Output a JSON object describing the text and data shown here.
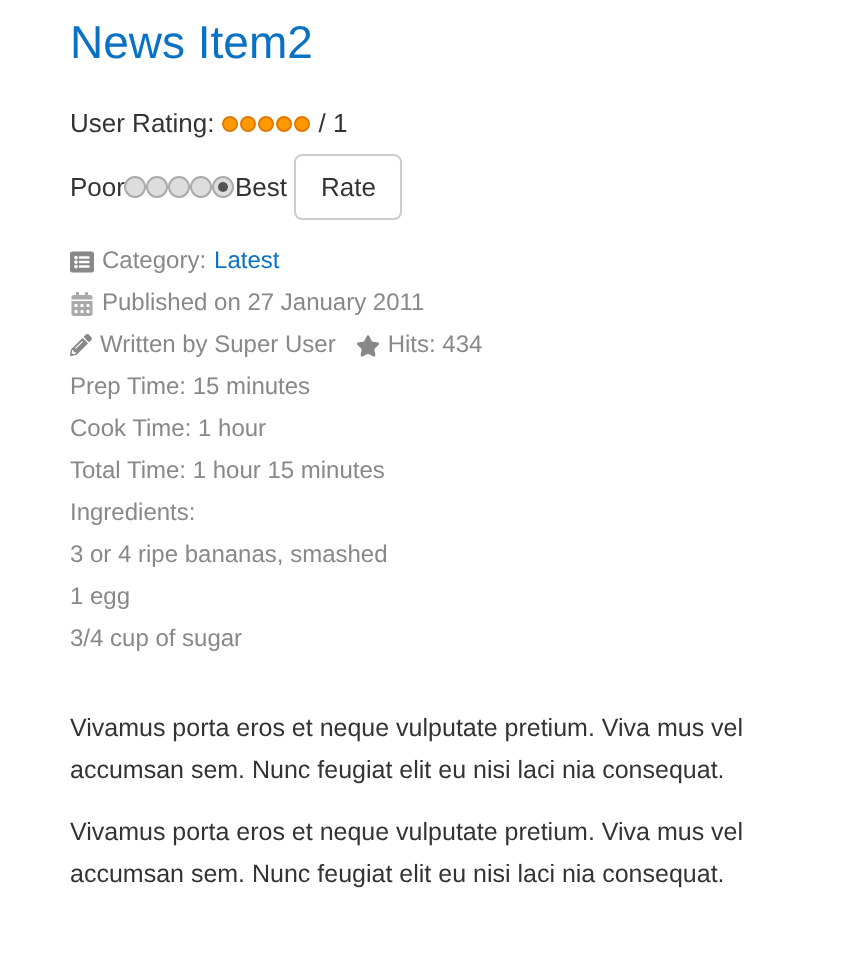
{
  "title": "News Item2",
  "rating": {
    "label": "User Rating:",
    "stars": 5,
    "suffix": "/ 1"
  },
  "vote": {
    "low": "Poor",
    "high": "Best",
    "options": [
      {
        "selected": false
      },
      {
        "selected": false
      },
      {
        "selected": false
      },
      {
        "selected": false
      },
      {
        "selected": true
      }
    ],
    "button": "Rate"
  },
  "info": [
    {
      "kind": "category",
      "label": "Category:",
      "link": "Latest"
    },
    {
      "kind": "published",
      "text": "Published on 27 January 2011"
    },
    {
      "kind": "author",
      "text": "Written by Super User",
      "hits": "Hits: 434"
    }
  ],
  "details": [
    "Prep Time: 15 minutes",
    "Cook Time: 1 hour",
    "Total Time: 1 hour 15 minutes",
    "Ingredients:",
    "3 or 4 ripe bananas, smashed",
    "1 egg",
    "3/4 cup of sugar"
  ],
  "paragraphs": [
    [
      "Vivamus porta eros et neque vulputate pretium. Viva mus vel",
      "accumsan sem. Nunc feugiat elit eu nisi laci nia consequat."
    ],
    [
      "Vivamus porta eros et neque vulputate pretium. Viva mus vel",
      "accumsan sem. Nunc feugiat elit eu nisi laci nia consequat."
    ]
  ]
}
